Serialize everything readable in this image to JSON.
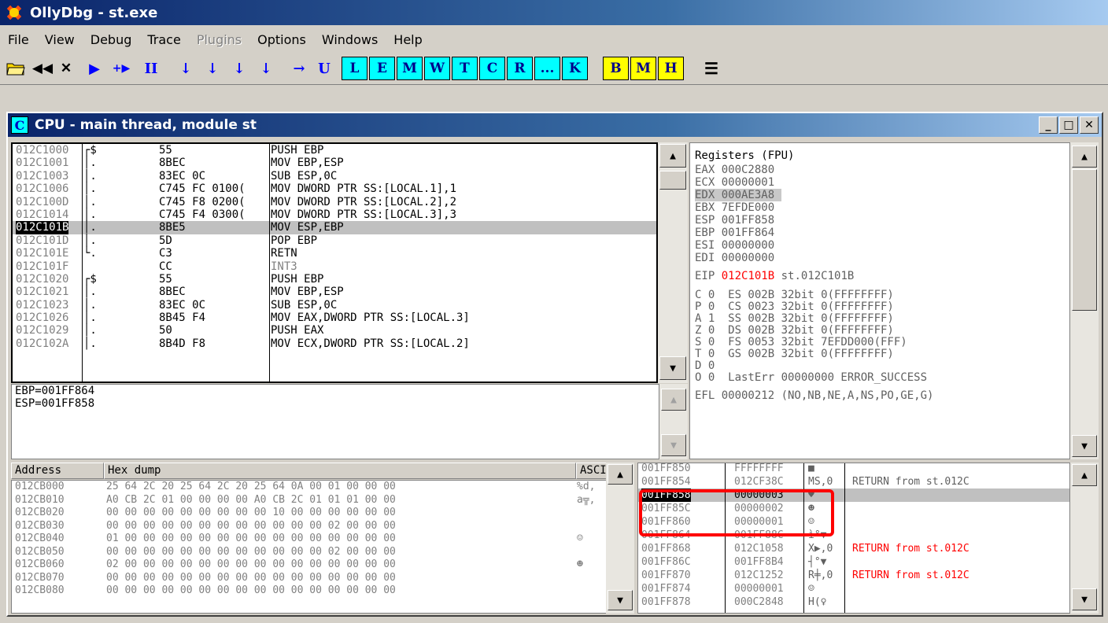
{
  "app": {
    "title": "OllyDbg - st.exe"
  },
  "menu": [
    "File",
    "View",
    "Debug",
    "Trace",
    "Plugins",
    "Options",
    "Windows",
    "Help"
  ],
  "toolbar": {
    "nav": [
      "▶",
      "+▶",
      "II"
    ],
    "step": [
      "↓",
      "↓",
      "↓",
      "↓",
      "→",
      "U"
    ],
    "windows": [
      "L",
      "E",
      "M",
      "W",
      "T",
      "C",
      "R",
      "...",
      "K"
    ],
    "bmh": [
      "B",
      "M",
      "H"
    ],
    "list": "☰"
  },
  "cpu": {
    "title": "CPU - main thread, module st",
    "icon_letter": "C"
  },
  "disasm": [
    {
      "addr": "012C1000",
      "mark": "┌$",
      "hex": "55",
      "instr": "PUSH EBP"
    },
    {
      "addr": "012C1001",
      "mark": "│.",
      "hex": "8BEC",
      "instr": "MOV EBP,ESP"
    },
    {
      "addr": "012C1003",
      "mark": "│.",
      "hex": "83EC 0C",
      "instr": "SUB ESP,0C"
    },
    {
      "addr": "012C1006",
      "mark": "│.",
      "hex": "C745 FC 0100(",
      "instr": "MOV DWORD PTR SS:[LOCAL.1],1"
    },
    {
      "addr": "012C100D",
      "mark": "│.",
      "hex": "C745 F8 0200(",
      "instr": "MOV DWORD PTR SS:[LOCAL.2],2"
    },
    {
      "addr": "012C1014",
      "mark": "│.",
      "hex": "C745 F4 0300(",
      "instr": "MOV DWORD PTR SS:[LOCAL.3],3"
    },
    {
      "addr": "012C101B",
      "mark": "│.",
      "hex": "8BE5",
      "instr": "MOV ESP,EBP"
    },
    {
      "addr": "012C101D",
      "mark": "│.",
      "hex": "5D",
      "instr": "POP EBP"
    },
    {
      "addr": "012C101E",
      "mark": "└.",
      "hex": "C3",
      "instr": "RETN"
    },
    {
      "addr": "012C101F",
      "mark": "  ",
      "hex": "CC",
      "instr": "INT3"
    },
    {
      "addr": "012C1020",
      "mark": "┌$",
      "hex": "55",
      "instr": "PUSH EBP"
    },
    {
      "addr": "012C1021",
      "mark": "│.",
      "hex": "8BEC",
      "instr": "MOV EBP,ESP"
    },
    {
      "addr": "012C1023",
      "mark": "│.",
      "hex": "83EC 0C",
      "instr": "SUB ESP,0C"
    },
    {
      "addr": "012C1026",
      "mark": "│.",
      "hex": "8B45 F4",
      "instr": "MOV EAX,DWORD PTR SS:[LOCAL.3]"
    },
    {
      "addr": "012C1029",
      "mark": "│.",
      "hex": "50",
      "instr": "PUSH EAX"
    },
    {
      "addr": "012C102A",
      "mark": "│.",
      "hex": "8B4D F8",
      "instr": "MOV ECX,DWORD PTR SS:[LOCAL.2]"
    }
  ],
  "info": [
    "EBP=001FF864",
    "ESP=001FF858"
  ],
  "registers": {
    "header": "Registers (FPU)",
    "gp": [
      "EAX 000C2880",
      "ECX 00000001",
      "EDX 000AE3A8",
      "EBX 7EFDE000",
      "ESP 001FF858",
      "EBP 001FF864",
      "ESI 00000000",
      "EDI 00000000"
    ],
    "eip_label": "EIP",
    "eip_value": "012C101B",
    "eip_comment": "st.012C101B",
    "flags": [
      "C 0  ES 002B 32bit 0(FFFFFFFF)",
      "P 0  CS 0023 32bit 0(FFFFFFFF)",
      "A 1  SS 002B 32bit 0(FFFFFFFF)",
      "Z 0  DS 002B 32bit 0(FFFFFFFF)",
      "S 0  FS 0053 32bit 7EFDD000(FFF)",
      "T 0  GS 002B 32bit 0(FFFFFFFF)",
      "D 0",
      "O 0  LastErr 00000000 ERROR_SUCCESS"
    ],
    "efl": "EFL 00000212 (NO,NB,NE,A,NS,PO,GE,G)"
  },
  "dump": {
    "headers": [
      "Address",
      "Hex dump",
      "ASCI"
    ],
    "rows": [
      {
        "addr": "012CB000",
        "hex": "25 64 2C 20 25 64 2C 20 25 64 0A 00 01 00 00 00",
        "ascii": "%d,"
      },
      {
        "addr": "012CB010",
        "hex": "A0 CB 2C 01 00 00 00 00 A0 CB 2C 01 01 01 00 00",
        "ascii": "a╦,"
      },
      {
        "addr": "012CB020",
        "hex": "00 00 00 00 00 00 00 00 00 10 00 00 00 00 00 00",
        "ascii": ""
      },
      {
        "addr": "012CB030",
        "hex": "00 00 00 00 00 00 00 00 00 00 00 00 02 00 00 00",
        "ascii": ""
      },
      {
        "addr": "012CB040",
        "hex": "01 00 00 00 00 00 00 00 00 00 00 00 00 00 00 00",
        "ascii": "☺"
      },
      {
        "addr": "012CB050",
        "hex": "00 00 00 00 00 00 00 00 00 00 00 00 02 00 00 00",
        "ascii": ""
      },
      {
        "addr": "012CB060",
        "hex": "02 00 00 00 00 00 00 00 00 00 00 00 00 00 00 00",
        "ascii": "☻"
      },
      {
        "addr": "012CB070",
        "hex": "00 00 00 00 00 00 00 00 00 00 00 00 00 00 00 00",
        "ascii": ""
      },
      {
        "addr": "012CB080",
        "hex": "00 00 00 00 00 00 00 00 00 00 00 00 00 00 00 00",
        "ascii": ""
      }
    ]
  },
  "stack": [
    {
      "addr": "001FF850",
      "val": "FFFFFFFF",
      "asc": "■",
      "cmt": ""
    },
    {
      "addr": "001FF854",
      "val": "012CF38C",
      "asc": "MS,0",
      "cmt": "RETURN from st.012C"
    },
    {
      "addr": "001FF858",
      "val": "00000003",
      "asc": "♥",
      "cmt": ""
    },
    {
      "addr": "001FF85C",
      "val": "00000002",
      "asc": "☻",
      "cmt": ""
    },
    {
      "addr": "001FF860",
      "val": "00000001",
      "asc": "☺",
      "cmt": ""
    },
    {
      "addr": "001FF864",
      "val": "001FF88C",
      "asc": "ì°▼",
      "cmt": ""
    },
    {
      "addr": "001FF868",
      "val": "012C1058",
      "asc": "X▶,0",
      "cmt": "RETURN from st.012C"
    },
    {
      "addr": "001FF86C",
      "val": "001FF8B4",
      "asc": "┤°▼",
      "cmt": ""
    },
    {
      "addr": "001FF870",
      "val": "012C1252",
      "asc": "R╪,0",
      "cmt": "RETURN from st.012C"
    },
    {
      "addr": "001FF874",
      "val": "00000001",
      "asc": "☺",
      "cmt": ""
    },
    {
      "addr": "001FF878",
      "val": "000C2848",
      "asc": "H(♀",
      "cmt": ""
    }
  ]
}
